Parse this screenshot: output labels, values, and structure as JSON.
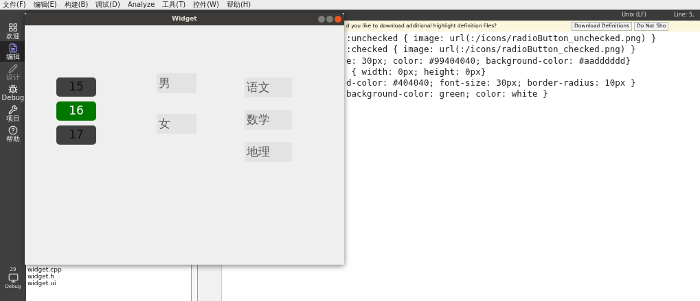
{
  "menu_bar": [
    "文件(F)",
    "编辑(E)",
    "构建(B)",
    "调试(D)",
    "Analyze",
    "工具(T)",
    "控件(W)",
    "帮助(H)"
  ],
  "sidebar": {
    "items": [
      {
        "label": "欢迎",
        "kind": "grid",
        "selected": false,
        "disabled": false
      },
      {
        "label": "编辑",
        "kind": "edit",
        "selected": true,
        "disabled": false
      },
      {
        "label": "设计",
        "kind": "design",
        "selected": false,
        "disabled": true
      },
      {
        "label": "Debug",
        "kind": "debug",
        "selected": false,
        "disabled": false
      },
      {
        "label": "项目",
        "kind": "project",
        "selected": false,
        "disabled": false
      },
      {
        "label": "帮助",
        "kind": "help",
        "selected": false,
        "disabled": false
      }
    ],
    "kit": {
      "number": "29",
      "label": "Debug"
    }
  },
  "status": {
    "line_ending": "Unix (LF)",
    "position": "Line: 5,"
  },
  "info_bar": {
    "message": "d you like to download additional highlight definition files?",
    "buttons": [
      "Download Definitions",
      "Do Not Sho"
    ]
  },
  "files": [
    "widget.cpp",
    "widget.h",
    "widget.ui"
  ],
  "code_lines": [
    ":unchecked { image: url(:/icons/radioButton_unchecked.png) }",
    ":checked { image: url(:/icons/radioButton_checked.png) }",
    "e: 30px; color: #99404040; background-color: #aadddddd}",
    " { width: 0px; height: 0px}",
    "d-color: #404040; font-size: 30px; border-radius: 10px }",
    "background-color: green; color: white }"
  ],
  "widget_window": {
    "title": "Widget",
    "age_buttons": [
      {
        "label": "15",
        "selected": false
      },
      {
        "label": "16",
        "selected": true
      },
      {
        "label": "17",
        "selected": false
      }
    ],
    "gender_options": [
      {
        "label": "男",
        "checked": false
      },
      {
        "label": "女",
        "checked": false
      }
    ],
    "subject_options": [
      {
        "label": "语文",
        "checked": false
      },
      {
        "label": "数学",
        "checked": false
      },
      {
        "label": "地理",
        "checked": false
      }
    ]
  }
}
